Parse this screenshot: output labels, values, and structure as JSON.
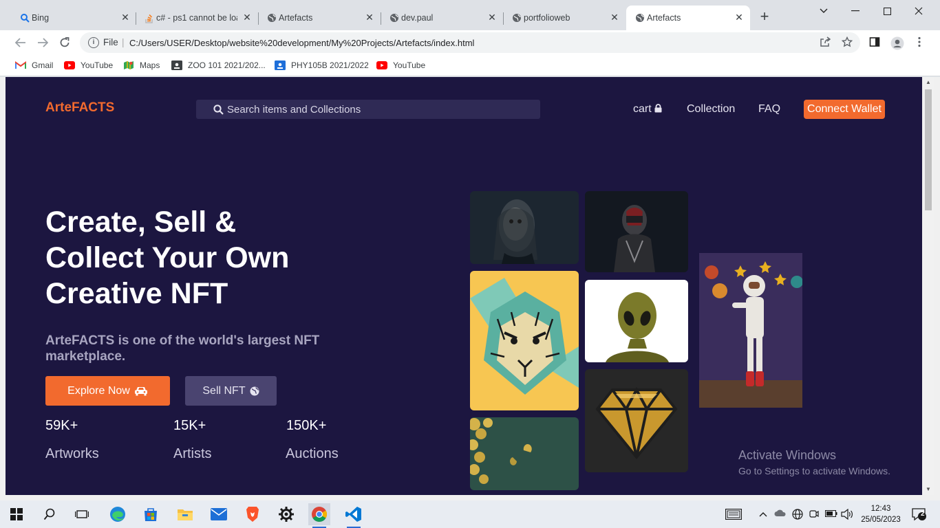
{
  "browser": {
    "tabs": [
      {
        "title": "Bing",
        "icon": "bing-search-icon",
        "active": false
      },
      {
        "title": "c# - ps1 cannot be loa",
        "icon": "stackoverflow-icon",
        "active": false
      },
      {
        "title": "Artefacts",
        "icon": "globe-icon",
        "active": false
      },
      {
        "title": "dev.paul",
        "icon": "globe-icon",
        "active": false
      },
      {
        "title": "portfolioweb",
        "icon": "globe-icon",
        "active": false
      },
      {
        "title": "Artefacts",
        "icon": "globe-icon",
        "active": true
      }
    ],
    "address": {
      "scheme": "File",
      "url": "C:/Users/USER/Desktop/website%20development/My%20Projects/Artefacts/index.html"
    },
    "bookmarks": [
      {
        "label": "Gmail",
        "icon": "gmail-icon"
      },
      {
        "label": "YouTube",
        "icon": "youtube-icon"
      },
      {
        "label": "Maps",
        "icon": "maps-icon"
      },
      {
        "label": "ZOO 101 2021/202...",
        "icon": "classroom-icon"
      },
      {
        "label": "PHY105B 2021/2022",
        "icon": "classroom-icon"
      },
      {
        "label": "YouTube",
        "icon": "youtube-icon"
      }
    ]
  },
  "site": {
    "logo": "ArteFACTS",
    "search_placeholder": "Search items and Collections",
    "nav": {
      "cart": "cart",
      "collection": "Collection",
      "faq": "FAQ",
      "connect": "Connect Wallet"
    },
    "hero": {
      "line1": "Create, Sell &",
      "line2": "Collect Your Own",
      "line3": "Creative NFT",
      "subtitle": "ArteFACTS is one of the world's largest NFT marketplace."
    },
    "buttons": {
      "explore": "Explore Now",
      "sell": "Sell NFT"
    },
    "stats": [
      {
        "value": "59K+",
        "label": "Artworks"
      },
      {
        "value": "15K+",
        "label": "Artists"
      },
      {
        "value": "150K+",
        "label": "Auctions"
      }
    ],
    "colors": {
      "accent": "#f26a2e",
      "background": "#1c1640"
    }
  },
  "watermark": {
    "title": "Activate Windows",
    "subtitle": "Go to Settings to activate Windows."
  },
  "taskbar": {
    "time": "12:43",
    "date": "25/05/2023",
    "notifications": "2"
  }
}
